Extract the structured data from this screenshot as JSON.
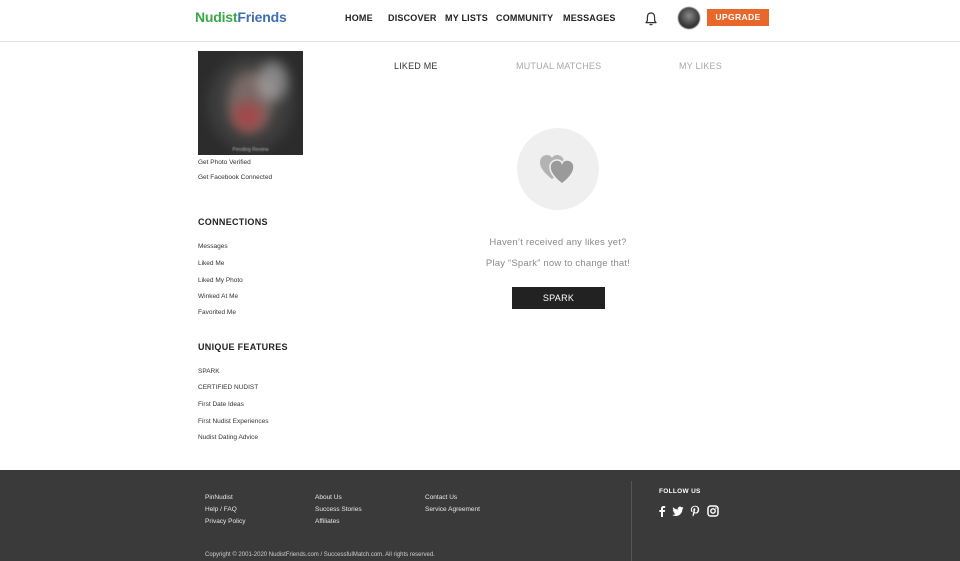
{
  "header": {
    "logo_part1": "Nudist",
    "logo_part2": "Friends",
    "nav": [
      "HOME",
      "DISCOVER",
      "MY LISTS",
      "COMMUNITY",
      "MESSAGES"
    ],
    "upgrade_label": "UPGRADE",
    "colors": {
      "logo_green": "#3aa84a",
      "logo_blue": "#3f6fb0",
      "upgrade_bg": "#e8682c"
    },
    "icons": [
      "bell-icon",
      "avatar"
    ]
  },
  "sidebar": {
    "photo_caption": "Pending Review",
    "verify_links": [
      "Get Photo Verified",
      "Get Facebook Connected"
    ],
    "connections_title": "CONNECTIONS",
    "connections": [
      "Messages",
      "Liked Me",
      "Liked My Photo",
      "Winked At Me",
      "Favorited Me"
    ],
    "features_title": "UNIQUE FEATURES",
    "features": [
      "SPARK",
      "CERTIFIED NUDIST",
      "First Date Ideas",
      "First Nudist Experiences",
      "Nudist Dating Advice"
    ]
  },
  "main": {
    "tabs": [
      "LIKED ME",
      "MUTUAL MATCHES",
      "MY LIKES"
    ],
    "active_tab": "LIKED ME",
    "empty_line1": "Haven’t received any likes yet?",
    "empty_line2": "Play “Spark” now to change that!",
    "spark_label": "SPARK",
    "empty_icon": "hearts-icon"
  },
  "footer": {
    "col1": [
      "PinNudist",
      "Help / FAQ",
      "Privacy Policy"
    ],
    "col2": [
      "About Us",
      "Success Stories",
      "Affiliates"
    ],
    "col3": [
      "Contact Us",
      "Service Agreement"
    ],
    "follow_label": "FOLLOW US",
    "social_icons": [
      "facebook-icon",
      "twitter-icon",
      "pinterest-icon",
      "instagram-icon"
    ],
    "copyright": "Copyright © 2001-2020 NudistFriends.com / SuccessfulMatch.com. All rights reserved.",
    "bg_color": "#3a3a3a"
  }
}
